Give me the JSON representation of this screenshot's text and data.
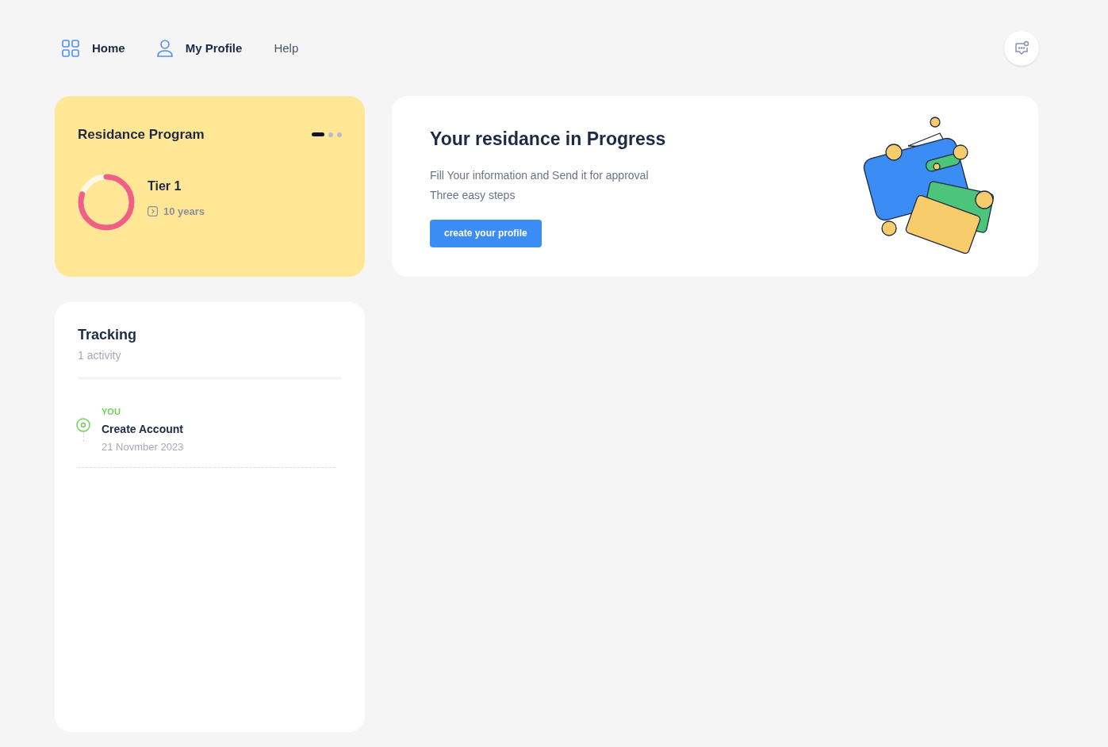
{
  "nav": [
    {
      "label": "Home"
    },
    {
      "label": "My Profile"
    },
    {
      "label": "Help"
    }
  ],
  "program_card": {
    "title": "Residance Program",
    "pager": [
      {
        "selected": true
      },
      {
        "selected": false
      },
      {
        "selected": false
      }
    ],
    "progress": {
      "level": 0.8
    },
    "tier": "Tier 1",
    "duration": "10 years"
  },
  "progress_card": {
    "title": "Your residance in Progress",
    "lines": [
      "Fill Your information and Send it for approval",
      "Three easy steps"
    ],
    "button": "create your profile"
  },
  "tracking": {
    "title": "Tracking",
    "subtitle": "1 activity",
    "activities": [
      {
        "actor": "YOU",
        "action": "Create Account",
        "date": "21 Novmber 2023"
      }
    ]
  }
}
